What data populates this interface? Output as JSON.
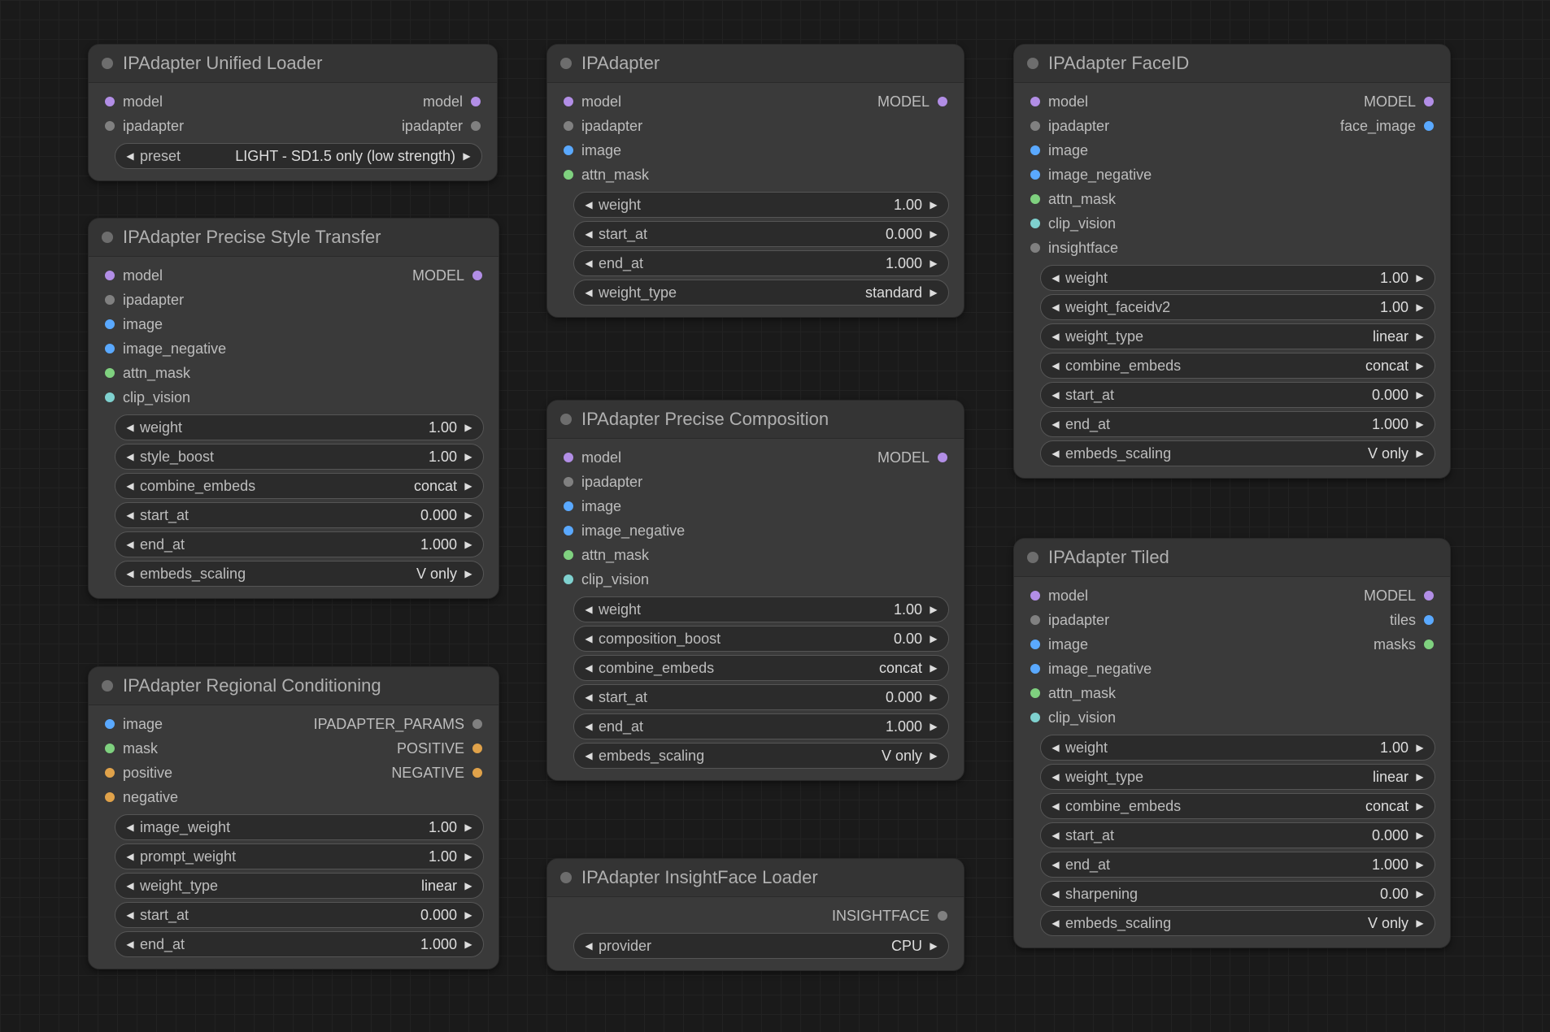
{
  "nodes": {
    "unified_loader": {
      "title": "IPAdapter Unified Loader",
      "inputs": [
        {
          "label": "model",
          "colorClass": "c-model"
        },
        {
          "label": "ipadapter",
          "colorClass": "c-ipadapter"
        }
      ],
      "outputs_align": [
        {
          "label": "model",
          "colorClass": "c-model"
        },
        {
          "label": "ipadapter",
          "colorClass": "c-ipadapter"
        }
      ],
      "params": [
        {
          "name": "preset",
          "value": "LIGHT - SD1.5 only (low strength)"
        }
      ]
    },
    "ipadapter": {
      "title": "IPAdapter",
      "inputs": [
        {
          "label": "model",
          "colorClass": "c-model"
        },
        {
          "label": "ipadapter",
          "colorClass": "c-ipadapter"
        },
        {
          "label": "image",
          "colorClass": "c-image"
        },
        {
          "label": "attn_mask",
          "colorClass": "c-attn"
        }
      ],
      "outputs_align": [
        {
          "label": "MODEL",
          "colorClass": "c-model"
        }
      ],
      "params": [
        {
          "name": "weight",
          "value": "1.00"
        },
        {
          "name": "start_at",
          "value": "0.000"
        },
        {
          "name": "end_at",
          "value": "1.000"
        },
        {
          "name": "weight_type",
          "value": "standard"
        }
      ]
    },
    "faceid": {
      "title": "IPAdapter FaceID",
      "inputs": [
        {
          "label": "model",
          "colorClass": "c-model"
        },
        {
          "label": "ipadapter",
          "colorClass": "c-ipadapter"
        },
        {
          "label": "image",
          "colorClass": "c-image"
        },
        {
          "label": "image_negative",
          "colorClass": "c-imageneg"
        },
        {
          "label": "attn_mask",
          "colorClass": "c-attn"
        },
        {
          "label": "clip_vision",
          "colorClass": "c-clip"
        },
        {
          "label": "insightface",
          "colorClass": "c-insight"
        }
      ],
      "outputs_align": [
        {
          "label": "MODEL",
          "colorClass": "c-model"
        },
        {
          "label": "face_image",
          "colorClass": "c-face"
        }
      ],
      "params": [
        {
          "name": "weight",
          "value": "1.00"
        },
        {
          "name": "weight_faceidv2",
          "value": "1.00"
        },
        {
          "name": "weight_type",
          "value": "linear"
        },
        {
          "name": "combine_embeds",
          "value": "concat"
        },
        {
          "name": "start_at",
          "value": "0.000"
        },
        {
          "name": "end_at",
          "value": "1.000"
        },
        {
          "name": "embeds_scaling",
          "value": "V only"
        }
      ]
    },
    "precise_style": {
      "title": "IPAdapter Precise Style Transfer",
      "inputs": [
        {
          "label": "model",
          "colorClass": "c-model"
        },
        {
          "label": "ipadapter",
          "colorClass": "c-ipadapter"
        },
        {
          "label": "image",
          "colorClass": "c-image"
        },
        {
          "label": "image_negative",
          "colorClass": "c-imageneg"
        },
        {
          "label": "attn_mask",
          "colorClass": "c-attn"
        },
        {
          "label": "clip_vision",
          "colorClass": "c-clip"
        }
      ],
      "outputs_align": [
        {
          "label": "MODEL",
          "colorClass": "c-model"
        }
      ],
      "params": [
        {
          "name": "weight",
          "value": "1.00"
        },
        {
          "name": "style_boost",
          "value": "1.00"
        },
        {
          "name": "combine_embeds",
          "value": "concat"
        },
        {
          "name": "start_at",
          "value": "0.000"
        },
        {
          "name": "end_at",
          "value": "1.000"
        },
        {
          "name": "embeds_scaling",
          "value": "V only"
        }
      ]
    },
    "precise_comp": {
      "title": "IPAdapter Precise Composition",
      "inputs": [
        {
          "label": "model",
          "colorClass": "c-model"
        },
        {
          "label": "ipadapter",
          "colorClass": "c-ipadapter"
        },
        {
          "label": "image",
          "colorClass": "c-image"
        },
        {
          "label": "image_negative",
          "colorClass": "c-imageneg"
        },
        {
          "label": "attn_mask",
          "colorClass": "c-attn"
        },
        {
          "label": "clip_vision",
          "colorClass": "c-clip"
        }
      ],
      "outputs_align": [
        {
          "label": "MODEL",
          "colorClass": "c-model"
        }
      ],
      "params": [
        {
          "name": "weight",
          "value": "1.00"
        },
        {
          "name": "composition_boost",
          "value": "0.00"
        },
        {
          "name": "combine_embeds",
          "value": "concat"
        },
        {
          "name": "start_at",
          "value": "0.000"
        },
        {
          "name": "end_at",
          "value": "1.000"
        },
        {
          "name": "embeds_scaling",
          "value": "V only"
        }
      ]
    },
    "regional": {
      "title": "IPAdapter Regional Conditioning",
      "inputs": [
        {
          "label": "image",
          "colorClass": "c-image"
        },
        {
          "label": "mask",
          "colorClass": "c-mask"
        },
        {
          "label": "positive",
          "colorClass": "c-positive"
        },
        {
          "label": "negative",
          "colorClass": "c-negative"
        }
      ],
      "outputs_align": [
        {
          "label": "IPADAPTER_PARAMS",
          "colorClass": "c-params"
        },
        {
          "label": "POSITIVE",
          "colorClass": "c-positive"
        },
        {
          "label": "NEGATIVE",
          "colorClass": "c-negative"
        }
      ],
      "params": [
        {
          "name": "image_weight",
          "value": "1.00"
        },
        {
          "name": "prompt_weight",
          "value": "1.00"
        },
        {
          "name": "weight_type",
          "value": "linear"
        },
        {
          "name": "start_at",
          "value": "0.000"
        },
        {
          "name": "end_at",
          "value": "1.000"
        }
      ]
    },
    "insight_loader": {
      "title": "IPAdapter InsightFace Loader",
      "inputs": [],
      "outputs_align": [
        {
          "label": "INSIGHTFACE",
          "colorClass": "c-insight"
        }
      ],
      "params": [
        {
          "name": "provider",
          "value": "CPU"
        }
      ]
    },
    "tiled": {
      "title": "IPAdapter Tiled",
      "inputs": [
        {
          "label": "model",
          "colorClass": "c-model"
        },
        {
          "label": "ipadapter",
          "colorClass": "c-ipadapter"
        },
        {
          "label": "image",
          "colorClass": "c-image"
        },
        {
          "label": "image_negative",
          "colorClass": "c-imageneg"
        },
        {
          "label": "attn_mask",
          "colorClass": "c-attn"
        },
        {
          "label": "clip_vision",
          "colorClass": "c-clip"
        }
      ],
      "outputs_align": [
        {
          "label": "MODEL",
          "colorClass": "c-model"
        },
        {
          "label": "tiles",
          "colorClass": "c-tiles"
        },
        {
          "label": "masks",
          "colorClass": "c-masks"
        }
      ],
      "params": [
        {
          "name": "weight",
          "value": "1.00"
        },
        {
          "name": "weight_type",
          "value": "linear"
        },
        {
          "name": "combine_embeds",
          "value": "concat"
        },
        {
          "name": "start_at",
          "value": "0.000"
        },
        {
          "name": "end_at",
          "value": "1.000"
        },
        {
          "name": "sharpening",
          "value": "0.00"
        },
        {
          "name": "embeds_scaling",
          "value": "V only"
        }
      ]
    }
  },
  "chart_data": null
}
